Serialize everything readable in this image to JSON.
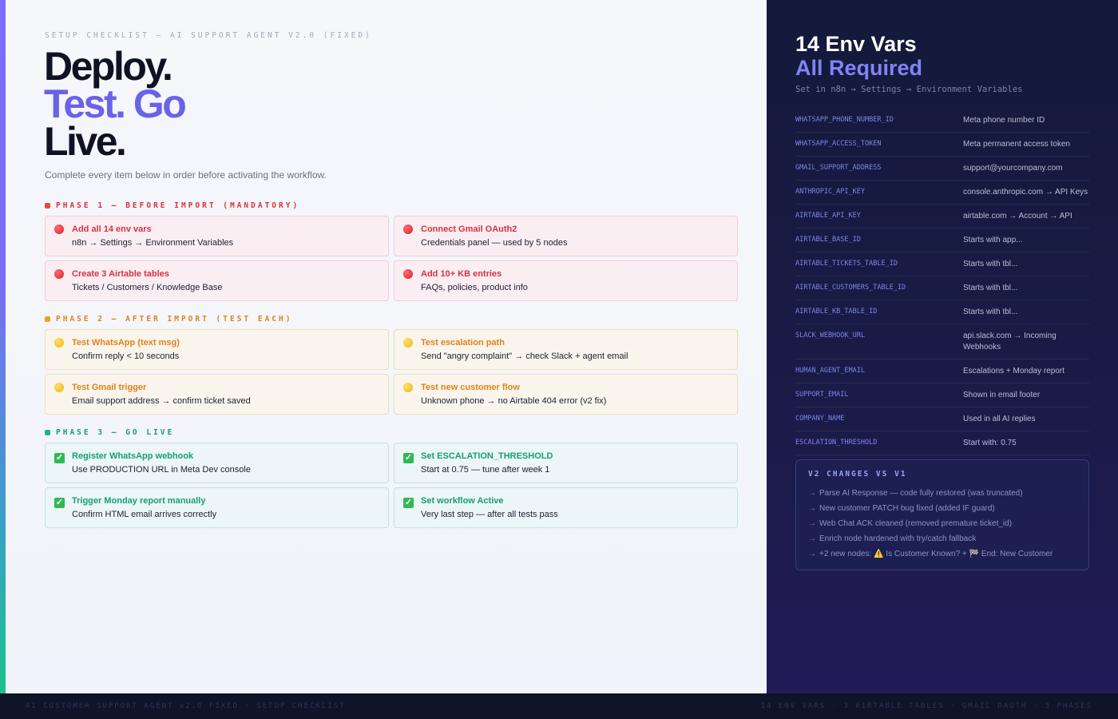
{
  "header": {
    "kicker": "SETUP CHECKLIST — AI SUPPORT AGENT V2.0 (FIXED)",
    "hero_line1": "Deploy.",
    "hero_line2": "Test. Go",
    "hero_line3": "Live.",
    "subtitle": "Complete every item below in order before activating the workflow."
  },
  "colors": {
    "phase1": "#d8323f",
    "phase2": "#e0821a",
    "phase3": "#16a072",
    "accent": "#6a62e8"
  },
  "phases": [
    {
      "label": "PHASE 1 — BEFORE IMPORT (MANDATORY)",
      "icon": "red-circle-icon",
      "items": [
        {
          "title": "Add all 14 env vars",
          "desc": "n8n → Settings → Environment Variables"
        },
        {
          "title": "Connect Gmail OAuth2",
          "desc": "Credentials panel — used by 5 nodes"
        },
        {
          "title": "Create 3 Airtable tables",
          "desc": "Tickets / Customers / Knowledge Base"
        },
        {
          "title": "Add 10+ KB entries",
          "desc": "FAQs, policies, product info"
        }
      ]
    },
    {
      "label": "PHASE 2 — AFTER IMPORT (TEST EACH)",
      "icon": "yellow-circle-icon",
      "items": [
        {
          "title": "Test WhatsApp (text msg)",
          "desc": "Confirm reply < 10 seconds"
        },
        {
          "title": "Test escalation path",
          "desc": "Send \"angry complaint\" → check Slack + agent email"
        },
        {
          "title": "Test Gmail trigger",
          "desc": "Email support address → confirm ticket saved"
        },
        {
          "title": "Test new customer flow",
          "desc": "Unknown phone → no Airtable 404 error (v2 fix)"
        }
      ]
    },
    {
      "label": "PHASE 3 — GO LIVE",
      "icon": "check-box-icon",
      "items": [
        {
          "title": "Register WhatsApp webhook",
          "desc": "Use PRODUCTION URL in Meta Dev console"
        },
        {
          "title": "Set ESCALATION_THRESHOLD",
          "desc": "Start at 0.75 — tune after week 1"
        },
        {
          "title": "Trigger Monday report manually",
          "desc": "Confirm HTML email arrives correctly"
        },
        {
          "title": "Set workflow Active",
          "desc": "Very last step — after all tests pass"
        }
      ]
    }
  ],
  "env_panel": {
    "title1": "14 Env Vars",
    "title2": "All Required",
    "subtitle": "Set in n8n → Settings → Environment Variables",
    "vars": [
      {
        "key": "WHATSAPP_PHONE_NUMBER_ID",
        "value": "Meta phone number ID"
      },
      {
        "key": "WHATSAPP_ACCESS_TOKEN",
        "value": "Meta permanent access token"
      },
      {
        "key": "GMAIL_SUPPORT_ADDRESS",
        "value": "support@yourcompany.com"
      },
      {
        "key": "ANTHROPIC_API_KEY",
        "value": "console.anthropic.com → API Keys"
      },
      {
        "key": "AIRTABLE_API_KEY",
        "value": "airtable.com → Account → API"
      },
      {
        "key": "AIRTABLE_BASE_ID",
        "value": "Starts with app..."
      },
      {
        "key": "AIRTABLE_TICKETS_TABLE_ID",
        "value": "Starts with tbl..."
      },
      {
        "key": "AIRTABLE_CUSTOMERS_TABLE_ID",
        "value": "Starts with tbl..."
      },
      {
        "key": "AIRTABLE_KB_TABLE_ID",
        "value": "Starts with tbl..."
      },
      {
        "key": "SLACK_WEBHOOK_URL",
        "value": "api.slack.com → Incoming Webhooks"
      },
      {
        "key": "HUMAN_AGENT_EMAIL",
        "value": "Escalations + Monday report"
      },
      {
        "key": "SUPPORT_EMAIL",
        "value": "Shown in email footer"
      },
      {
        "key": "COMPANY_NAME",
        "value": "Used in all AI replies"
      },
      {
        "key": "ESCALATION_THRESHOLD",
        "value": "Start with: 0.75"
      }
    ]
  },
  "changes": {
    "title": "V2 CHANGES VS V1",
    "arrow": "→",
    "items": [
      "Parse AI Response — code fully restored (was truncated)",
      "New customer PATCH bug fixed (added IF guard)",
      "Web Chat ACK cleaned (removed premature ticket_id)",
      "Enrich node hardened with try/catch fallback",
      "+2 new nodes: ⚠️ Is Customer Known? + 🏁 End: New Customer"
    ]
  },
  "footer": {
    "left": "AI CUSTOMER SUPPORT AGENT v2.0 FIXED · SETUP CHECKLIST",
    "right": "14 ENV VARS · 3 AIRTABLE TABLES · GMAIL OAUTH · 3 PHASES"
  }
}
